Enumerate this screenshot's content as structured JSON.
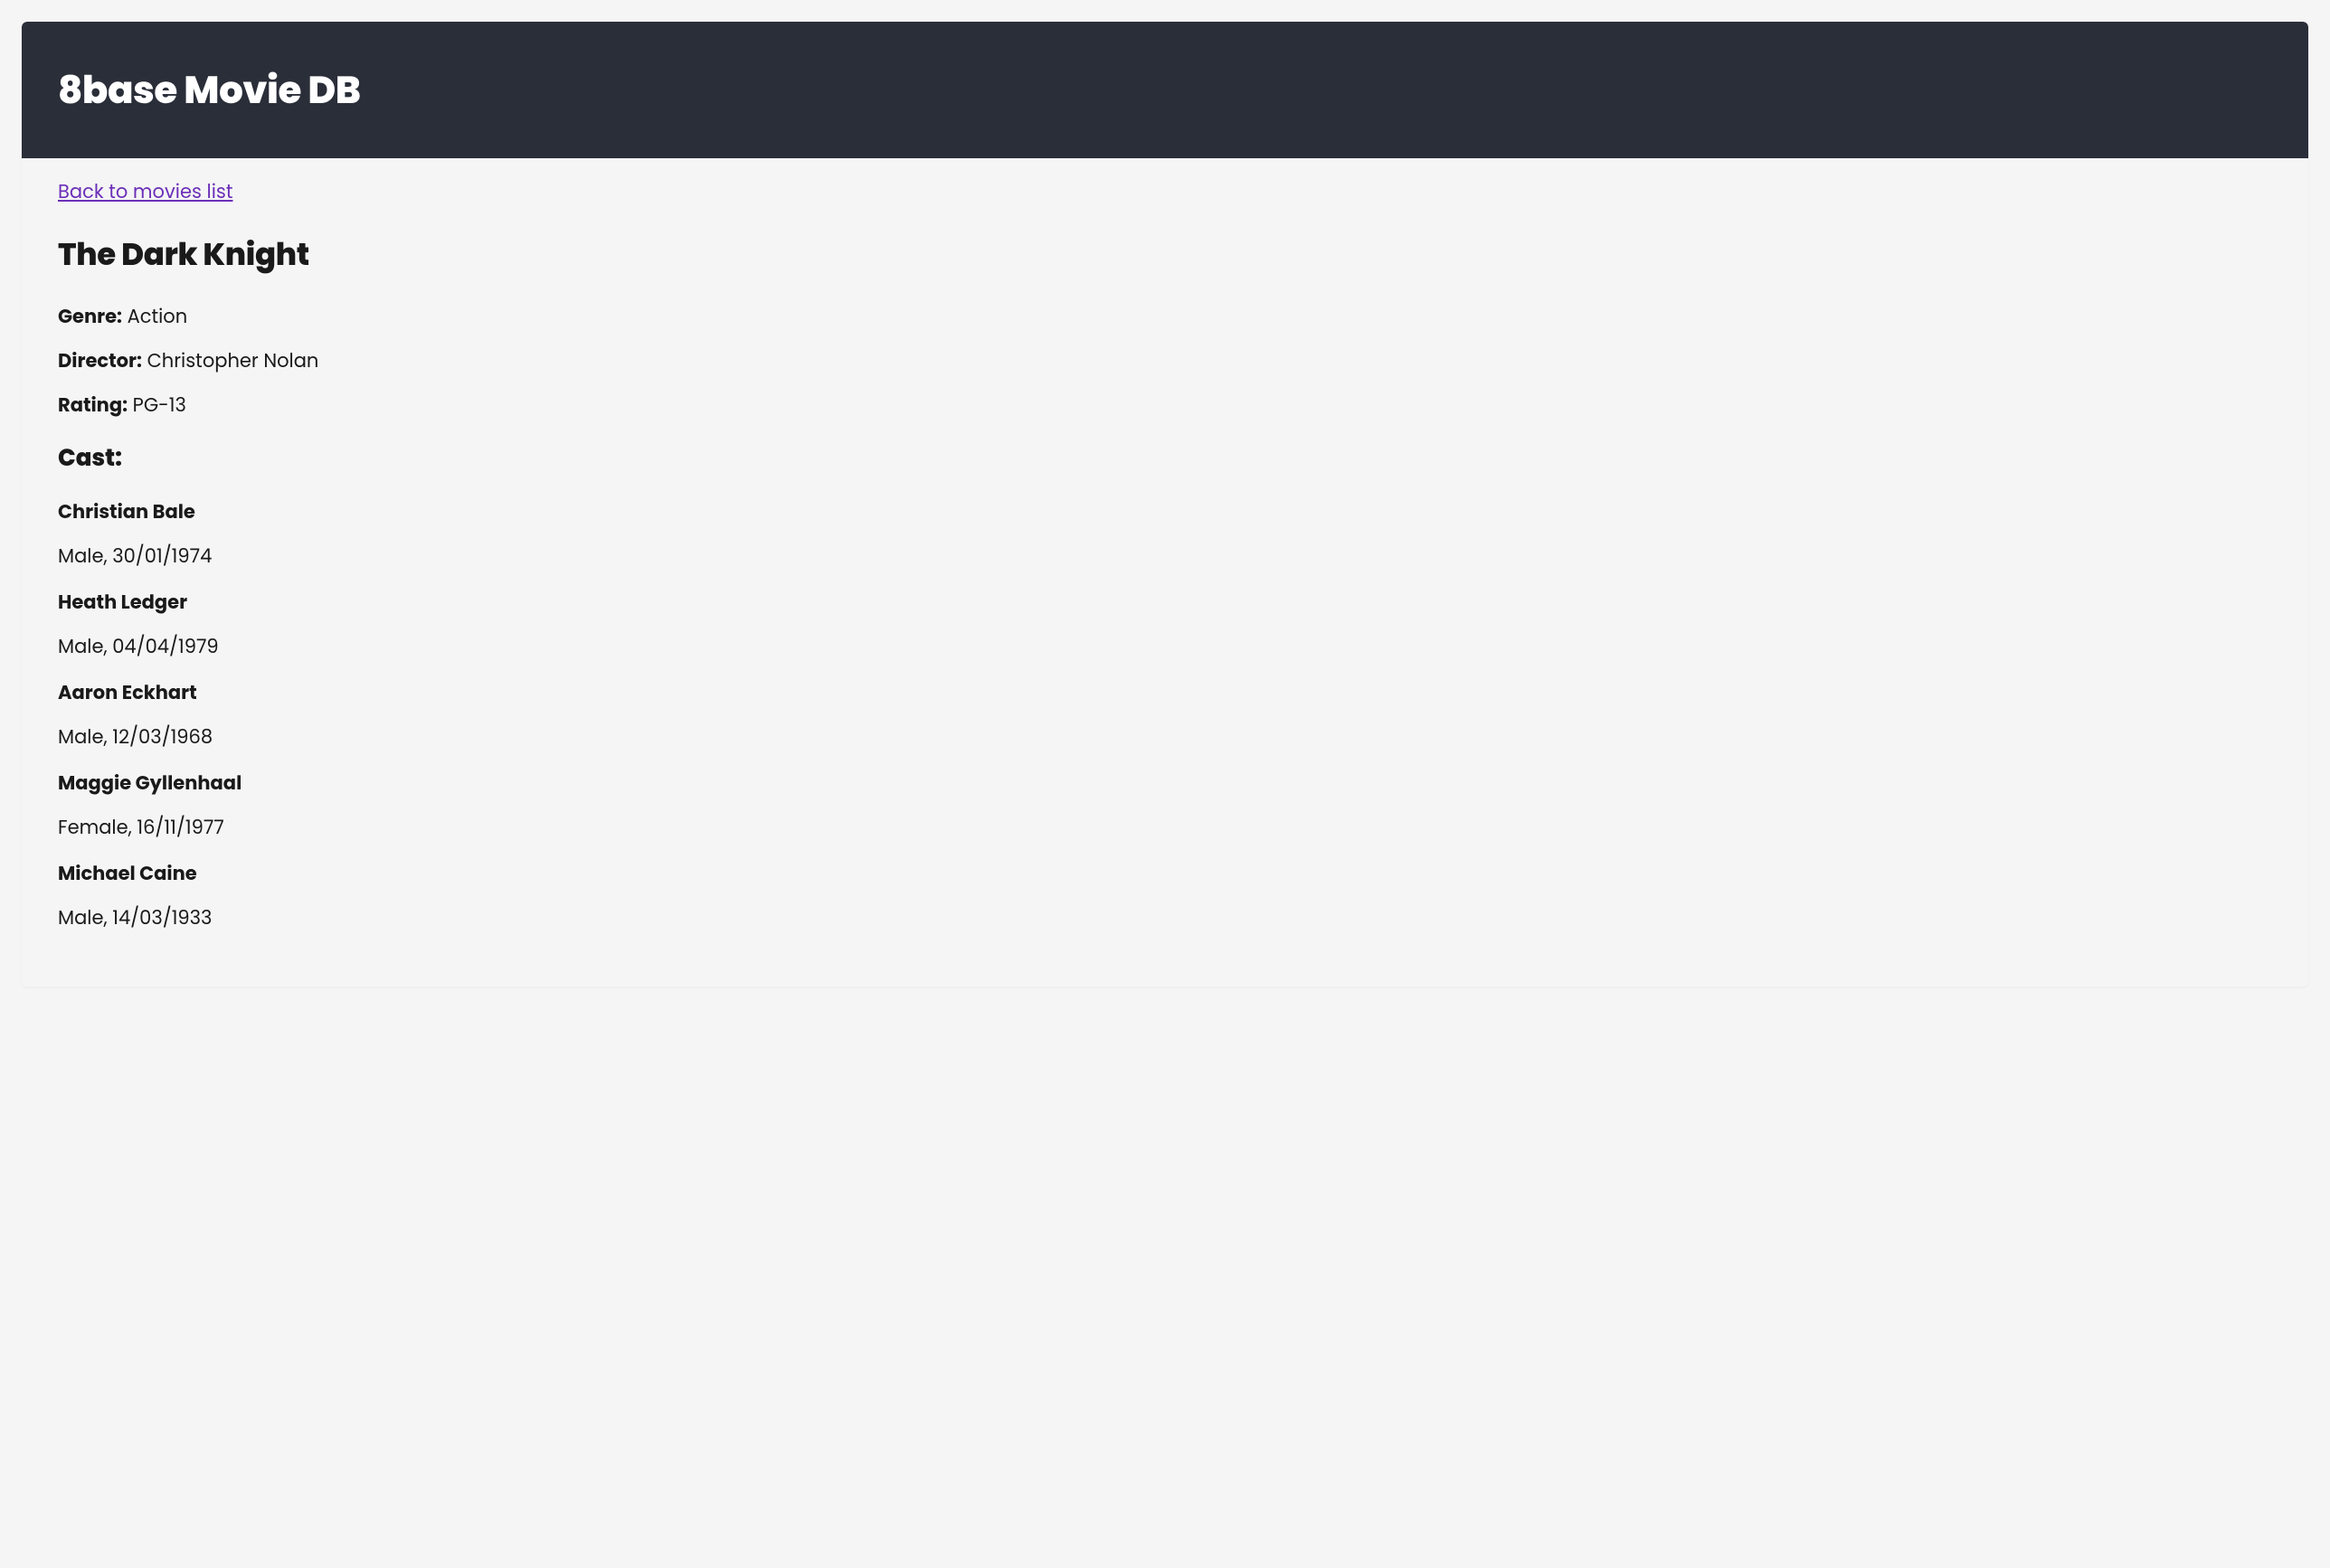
{
  "header": {
    "title": "8base Movie DB"
  },
  "nav": {
    "back_link": "Back to movies list"
  },
  "movie": {
    "title": "The Dark Knight",
    "genre_label": "Genre:",
    "genre_value": "Action",
    "director_label": "Director:",
    "director_value": "Christopher Nolan",
    "rating_label": "Rating:",
    "rating_value": "PG-13"
  },
  "cast": {
    "heading": "Cast:",
    "members": [
      {
        "name": "Christian Bale",
        "info": "Male, 30/01/1974"
      },
      {
        "name": "Heath Ledger",
        "info": "Male, 04/04/1979"
      },
      {
        "name": "Aaron Eckhart",
        "info": "Male, 12/03/1968"
      },
      {
        "name": "Maggie Gyllenhaal",
        "info": "Female, 16/11/1977"
      },
      {
        "name": "Michael Caine",
        "info": "Male, 14/03/1933"
      }
    ]
  }
}
